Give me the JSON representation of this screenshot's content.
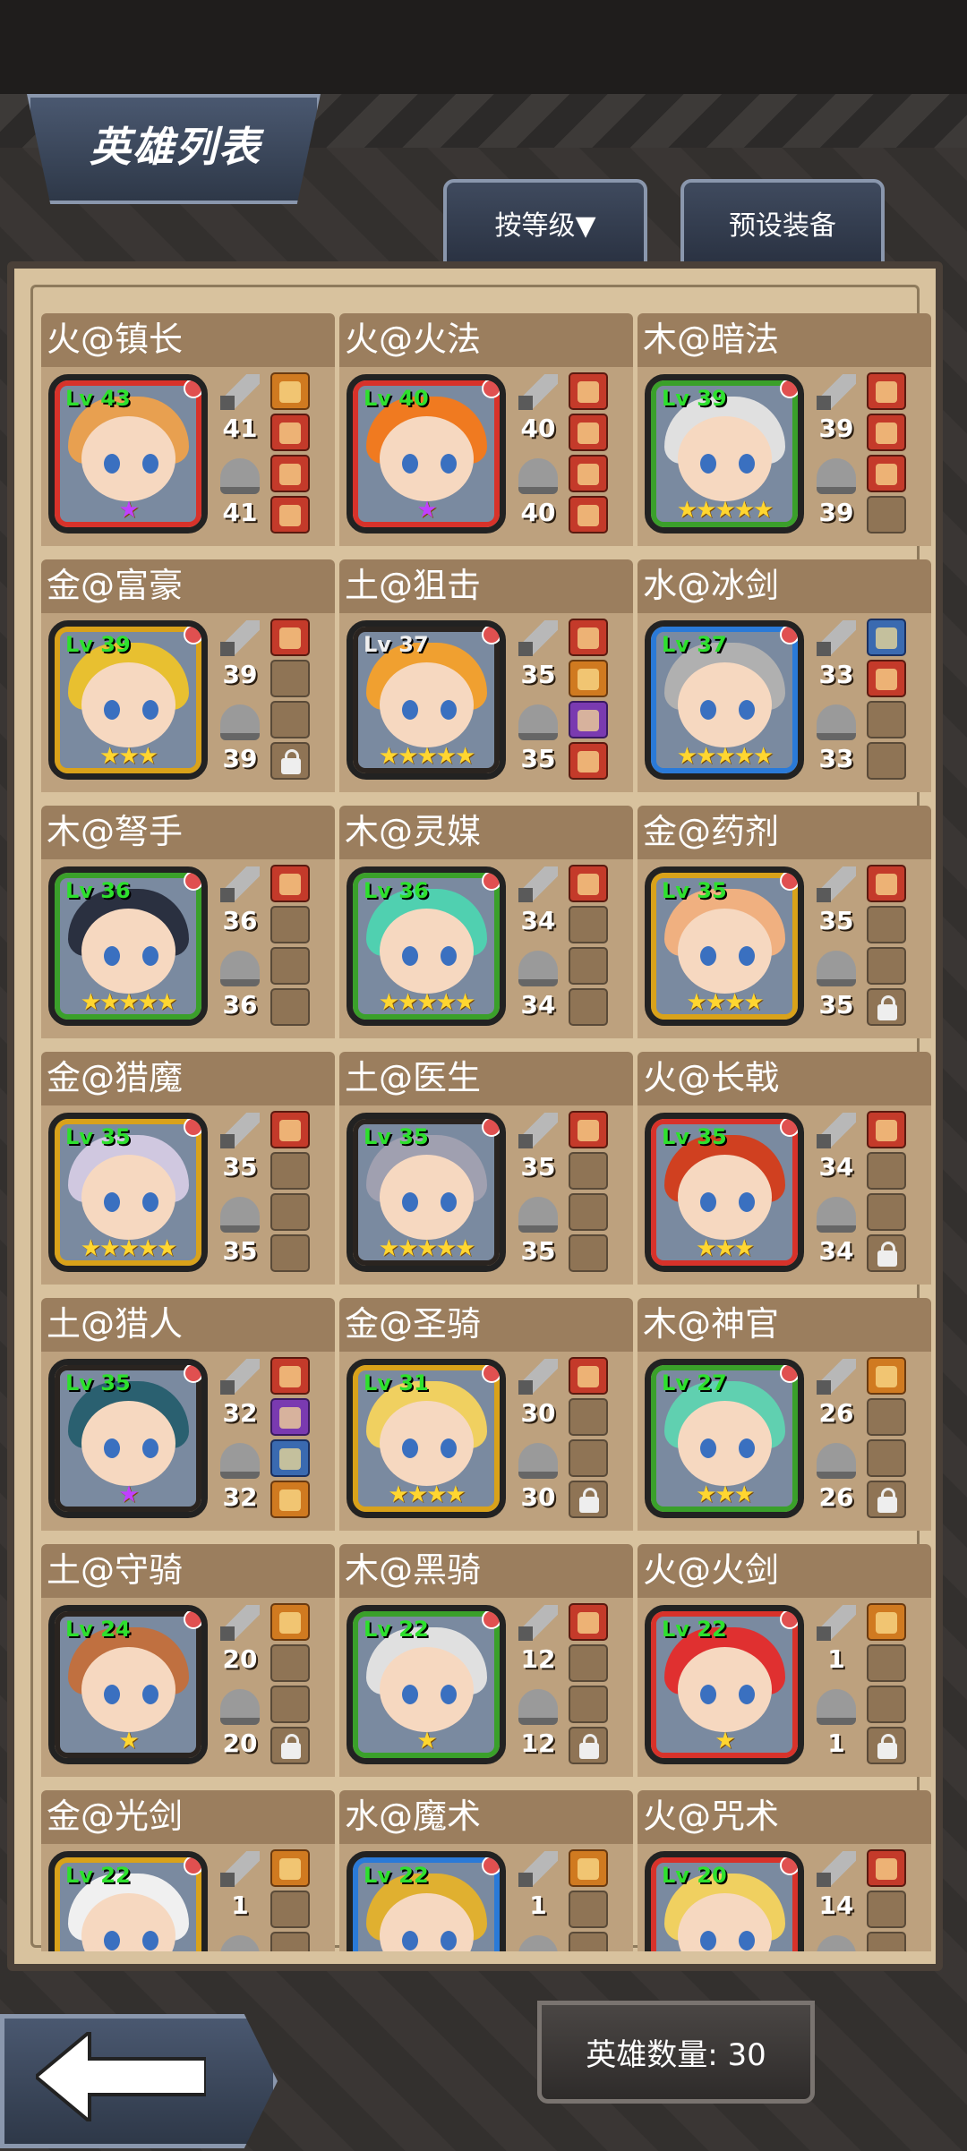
{
  "header": {
    "title": "英雄列表",
    "sort_button": "按等级▼",
    "preset_button": "预设装备"
  },
  "footer": {
    "hero_count_label": "英雄数量: 30"
  },
  "colors": {
    "fire": "#d8322a",
    "gold": "#d9a21a",
    "wood": "#3aa02a",
    "water": "#2a7ad8",
    "earth": "#2a2420"
  },
  "heroes": [
    {
      "name": "火@镇长",
      "lv": "Lv 43",
      "atk": "41",
      "def": "41",
      "frame": "fire",
      "stars": "★",
      "star_color": "purple",
      "hair": "#e8a050",
      "slots": [
        "orange",
        "red",
        "red",
        "red"
      ]
    },
    {
      "name": "火@火法",
      "lv": "Lv 40",
      "atk": "40",
      "def": "40",
      "frame": "fire",
      "stars": "★",
      "star_color": "purple",
      "hair": "#f07a20",
      "slots": [
        "red",
        "red",
        "red",
        "red"
      ]
    },
    {
      "name": "木@暗法",
      "lv": "Lv 39",
      "atk": "39",
      "def": "39",
      "frame": "wood",
      "stars": "★★★★★",
      "star_color": "gold",
      "hair": "#e0e0e0",
      "slots": [
        "red",
        "red",
        "red",
        "empty"
      ]
    },
    {
      "name": "金@富豪",
      "lv": "Lv 39",
      "atk": "39",
      "def": "39",
      "frame": "gold",
      "stars": "★★★",
      "star_color": "gold",
      "hair": "#e8c030",
      "slots": [
        "red",
        "empty",
        "empty",
        "lock"
      ]
    },
    {
      "name": "土@狙击",
      "lv": "Lv 37",
      "lv_white": true,
      "atk": "35",
      "def": "35",
      "frame": "earth",
      "stars": "★★★★★",
      "star_color": "gold",
      "hair": "#f0a030",
      "slots": [
        "red",
        "orange",
        "purple",
        "red"
      ]
    },
    {
      "name": "水@冰剑",
      "lv": "Lv 37",
      "atk": "33",
      "def": "33",
      "frame": "water",
      "stars": "★★★★★",
      "star_color": "gold",
      "hair": "#b0b0b0",
      "slots": [
        "blue",
        "red",
        "empty",
        "empty"
      ]
    },
    {
      "name": "木@弩手",
      "lv": "Lv 36",
      "atk": "36",
      "def": "36",
      "frame": "wood",
      "stars": "★★★★★",
      "star_color": "gold",
      "hair": "#2a3040",
      "slots": [
        "red",
        "empty",
        "empty",
        "empty"
      ]
    },
    {
      "name": "木@灵媒",
      "lv": "Lv 36",
      "atk": "34",
      "def": "34",
      "frame": "wood",
      "stars": "★★★★★",
      "star_color": "gold",
      "hair": "#50d0b0",
      "slots": [
        "red",
        "empty",
        "empty",
        "empty"
      ]
    },
    {
      "name": "金@药剂",
      "lv": "Lv 35",
      "atk": "35",
      "def": "35",
      "frame": "gold",
      "stars": "★★★★",
      "star_color": "gold",
      "hair": "#f0b080",
      "slots": [
        "red",
        "empty",
        "empty",
        "lock"
      ]
    },
    {
      "name": "金@猎魔",
      "lv": "Lv 35",
      "atk": "35",
      "def": "35",
      "frame": "gold",
      "stars": "★★★★★",
      "star_color": "gold",
      "hair": "#d0c8e0",
      "slots": [
        "red",
        "empty",
        "empty",
        "empty"
      ]
    },
    {
      "name": "土@医生",
      "lv": "Lv 35",
      "atk": "35",
      "def": "35",
      "frame": "earth",
      "stars": "★★★★★",
      "star_color": "gold",
      "hair": "#a0a0b0",
      "slots": [
        "red",
        "empty",
        "empty",
        "empty"
      ]
    },
    {
      "name": "火@长戟",
      "lv": "Lv 35",
      "atk": "34",
      "def": "34",
      "frame": "fire",
      "stars": "★★★",
      "star_color": "gold",
      "hair": "#d04020",
      "slots": [
        "red",
        "empty",
        "empty",
        "lock"
      ]
    },
    {
      "name": "土@猎人",
      "lv": "Lv 35",
      "atk": "32",
      "def": "32",
      "frame": "earth",
      "stars": "★",
      "star_color": "purple",
      "hair": "#2a6070",
      "slots": [
        "red",
        "purple",
        "blue",
        "orange"
      ]
    },
    {
      "name": "金@圣骑",
      "lv": "Lv 31",
      "atk": "30",
      "def": "30",
      "frame": "gold",
      "stars": "★★★★",
      "star_color": "gold",
      "hair": "#f0d060",
      "slots": [
        "red",
        "empty",
        "empty",
        "lock"
      ]
    },
    {
      "name": "木@神官",
      "lv": "Lv 27",
      "atk": "26",
      "def": "26",
      "frame": "wood",
      "stars": "★★★",
      "star_color": "gold",
      "hair": "#60d0b0",
      "slots": [
        "orange",
        "empty",
        "empty",
        "lock"
      ]
    },
    {
      "name": "土@守骑",
      "lv": "Lv 24",
      "atk": "20",
      "def": "20",
      "frame": "earth",
      "stars": "★",
      "star_color": "gold",
      "hair": "#c07040",
      "slots": [
        "orange",
        "empty",
        "empty",
        "lock"
      ]
    },
    {
      "name": "木@黑骑",
      "lv": "Lv 22",
      "atk": "12",
      "def": "12",
      "frame": "wood",
      "stars": "★",
      "star_color": "gold",
      "hair": "#e0e0e0",
      "slots": [
        "red",
        "empty",
        "empty",
        "lock"
      ]
    },
    {
      "name": "火@火剑",
      "lv": "Lv 22",
      "atk": "1",
      "def": "1",
      "frame": "fire",
      "stars": "★",
      "star_color": "gold",
      "hair": "#e03030",
      "slots": [
        "orange",
        "empty",
        "empty",
        "lock"
      ]
    },
    {
      "name": "金@光剑",
      "lv": "Lv 22",
      "atk": "1",
      "def": "",
      "frame": "gold",
      "stars": "",
      "star_color": "gold",
      "hair": "#f0f0f0",
      "slots": [
        "orange",
        "empty",
        "empty",
        "empty"
      ]
    },
    {
      "name": "水@魔术",
      "lv": "Lv 22",
      "atk": "1",
      "def": "",
      "frame": "water",
      "stars": "",
      "star_color": "gold",
      "hair": "#e0b030",
      "slots": [
        "orange",
        "empty",
        "empty",
        "empty"
      ]
    },
    {
      "name": "火@咒术",
      "lv": "Lv 20",
      "atk": "14",
      "def": "",
      "frame": "fire",
      "stars": "",
      "star_color": "gold",
      "hair": "#f0d060",
      "slots": [
        "red",
        "empty",
        "empty",
        "empty"
      ]
    }
  ]
}
